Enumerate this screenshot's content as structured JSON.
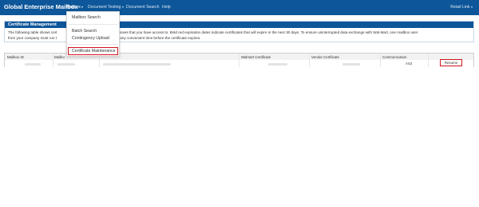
{
  "navbar": {
    "brand": "Global Enterprise Mailbox",
    "items": [
      {
        "label": "Mailbox",
        "dropdown": true,
        "active": true
      },
      {
        "label": "Document Testing",
        "dropdown": true,
        "active": false
      },
      {
        "label": "Document Search",
        "dropdown": false,
        "active": false
      },
      {
        "label": "Help",
        "dropdown": false,
        "active": false
      }
    ],
    "right_link": "Retail Link"
  },
  "mailbox_menu": {
    "items": [
      "Mailbox Search",
      "Batch Search",
      "Contingency Upload",
      "Certificate Maintenance"
    ],
    "highlighted": "Certificate Maintenance"
  },
  "panel": {
    "title": "Certificate Management",
    "line1_left": "The following table shows cert",
    "line1_right": "r the mailboxes that you have access to. Bold red expiration dates indicate certificates that will expire in the next 30 days. To ensure uninterrupted data exchange with Wal-Mart, one mailbox user",
    "line2_left": "from your company must run t",
    "line2_right": "' at any convenient time before the certificate expires."
  },
  "table": {
    "headers": [
      "Mailbox ID",
      "Mailbo",
      "",
      "Walmart Certificate",
      "Vendor Certificate",
      "Communication",
      ""
    ],
    "row": {
      "communication": "AS2",
      "action": "Resume"
    }
  },
  "colors": {
    "brand_blue": "#0d5699",
    "highlight_red": "#d0141c"
  }
}
